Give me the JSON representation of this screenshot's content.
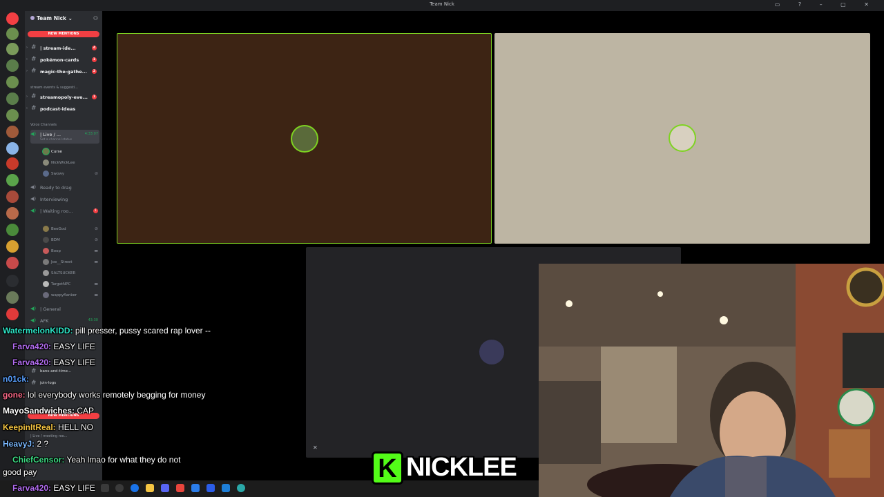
{
  "window": {
    "title": "Team Nick"
  },
  "server": {
    "name": "Team Nick",
    "new_mentions_top": "NEW MENTIONS",
    "new_mentions_bottom": "NEW MENTIONS",
    "channels": [
      {
        "name": "| stream-ide...",
        "badge": "4"
      },
      {
        "name": "pokémon-cards",
        "badge": "1"
      },
      {
        "name": "magic-the-gathe...",
        "badge": "2"
      },
      {
        "name": "streamopoly-eve...",
        "badge": "1"
      },
      {
        "name": "podcast-ideas",
        "badge": ""
      }
    ],
    "category_stream": "stream events & suggesti...",
    "category_voice": "Voice Channels",
    "live_channel": {
      "name": "| Live / ...",
      "time": "4:33:07",
      "status": "Set a channel status"
    },
    "live_users": [
      "Curse",
      "NickWickLee",
      "Swowy"
    ],
    "ready_to_drag": "Ready to drag",
    "interviewing": "Interviewing",
    "waiting_room": {
      "name": "| Waiting roo...",
      "badge": "1"
    },
    "waiting_users": [
      "BeeGod",
      "BDM",
      "Boop",
      "Joe__Street",
      "SALTSUCKER",
      "TargetNPC",
      "wappyflanker"
    ],
    "general": "| General",
    "afk": {
      "name": "AFK",
      "time": "43:30"
    },
    "bans": "bans-and-time...",
    "join_logs": "join-logs",
    "bottom_live": "| Live / meeting roo..."
  },
  "chat": [
    {
      "user": "WatermelonKIDD:",
      "color": "#2ee6c8",
      "text": "pill presser, pussy scared rap lover --"
    },
    {
      "user": "Farva420:",
      "color": "#b26cf0",
      "text": "EASY LIFE"
    },
    {
      "user": "Farva420:",
      "color": "#b26cf0",
      "text": "EASY LIFE"
    },
    {
      "user": "n01ck:",
      "color": "#5aa0ff",
      "text": ""
    },
    {
      "user": "gone:",
      "color": "#ff6b8a",
      "text": "lol everybody works remotely begging for money"
    },
    {
      "user": "MayoSandwiches:",
      "color": "#ffffff",
      "text": "CAP"
    },
    {
      "user": "KeepinItReal:",
      "color": "#f5c542",
      "text": "HELL NO"
    },
    {
      "user": "HeavyJ:",
      "color": "#7ab8ff",
      "text": "2 ?"
    },
    {
      "user": "ChiefCensor:",
      "color": "#3ddc84",
      "text": "Yeah lmao for what they do not"
    },
    {
      "user": "",
      "color": "#ffffff",
      "text": "good pay"
    },
    {
      "user": "Farva420:",
      "color": "#b26cf0",
      "text": "EASY LIFE"
    }
  ],
  "logo": {
    "letter": "K",
    "word": "NICKLEE"
  },
  "colors": {
    "tile_brown": "#3d2414",
    "tile_beige": "#bdb5a3",
    "tile_dark": "#232326",
    "kick_green": "#53fc18",
    "speaking": "#7ed321"
  }
}
